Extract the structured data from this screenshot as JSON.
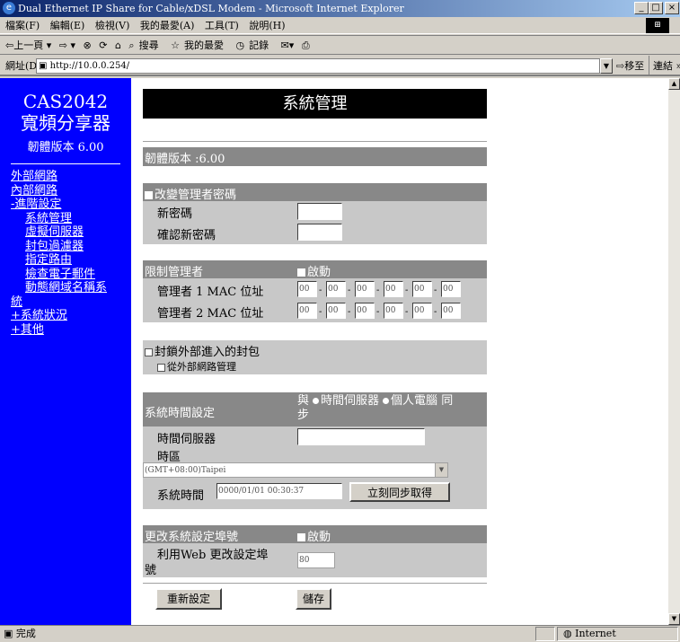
{
  "window": {
    "title": "Dual Ethernet IP Share for Cable/xDSL Modem - Microsoft Internet Explorer",
    "min": "_",
    "max": "□",
    "close": "×"
  },
  "menu": [
    "檔案(F)",
    "編輯(E)",
    "檢視(V)",
    "我的最愛(A)",
    "工具(T)",
    "說明(H)"
  ],
  "toolbar": {
    "back": "⇦上一頁 ▾",
    "forward": "⇨ ▾",
    "stop": "⊗",
    "refresh": "⟳",
    "home": "⌂",
    "search": "搜尋",
    "favorites": "我的最愛",
    "history": "記錄",
    "mail": "✉▾",
    "print": "⎙"
  },
  "address": {
    "label": "網址(D)",
    "url": "http://10.0.0.254/",
    "go": "⇨移至",
    "links": "連結 »"
  },
  "sidebar": {
    "model": "CAS2042",
    "product": "寬頻分享器",
    "firmware": "韌體版本 6.00",
    "items": [
      {
        "label": "外部網路"
      },
      {
        "label": "內部網路"
      },
      {
        "label": "-進階設定"
      },
      {
        "label": "系統管理"
      },
      {
        "label": "虛擬伺服器"
      },
      {
        "label": "封包過濾器"
      },
      {
        "label": "指定路由"
      },
      {
        "label": "檢查電子郵件"
      },
      {
        "label": "動態網域名稱系"
      },
      {
        "label": "統"
      },
      {
        "label": "+系統狀況"
      },
      {
        "label": "+其他"
      }
    ]
  },
  "page": {
    "title": "系統管理",
    "firmware_row": "韌體版本 :6.00",
    "password": {
      "header": "改變管理者密碼",
      "new_label": "新密碼",
      "confirm_label": "確認新密碼"
    },
    "restrict": {
      "header": "限制管理者",
      "enable": "啟動",
      "mac1_label": "管理者 1 MAC 位址",
      "mac2_label": "管理者 2 MAC 位址",
      "mac_default": "00",
      "sep": "-"
    },
    "block": {
      "label": "封鎖外部進入的封包",
      "remote": "從外部網路管理"
    },
    "time": {
      "header": "系統時間設定",
      "sync_with": "與",
      "opt_server": "時間伺服器",
      "opt_pc": "個人電腦",
      "sync": "同",
      "sync_tail": "步",
      "server_label": "時間伺服器",
      "zone_label": "時區",
      "zone_value": "(GMT+08:00)Taipei",
      "systime_label": "系統時間",
      "systime_value": "0000/01/01 00:30:37",
      "sync_button": "立刻同步取得"
    },
    "port": {
      "header": "更改系統設定埠號",
      "enable": "啟動",
      "web_label": "利用Web 更改設定埠",
      "web_label2": "號",
      "port_value": "80"
    },
    "reset_button": "重新設定",
    "save_button": "儲存"
  },
  "status": {
    "text": "完成",
    "zone": "Internet"
  }
}
